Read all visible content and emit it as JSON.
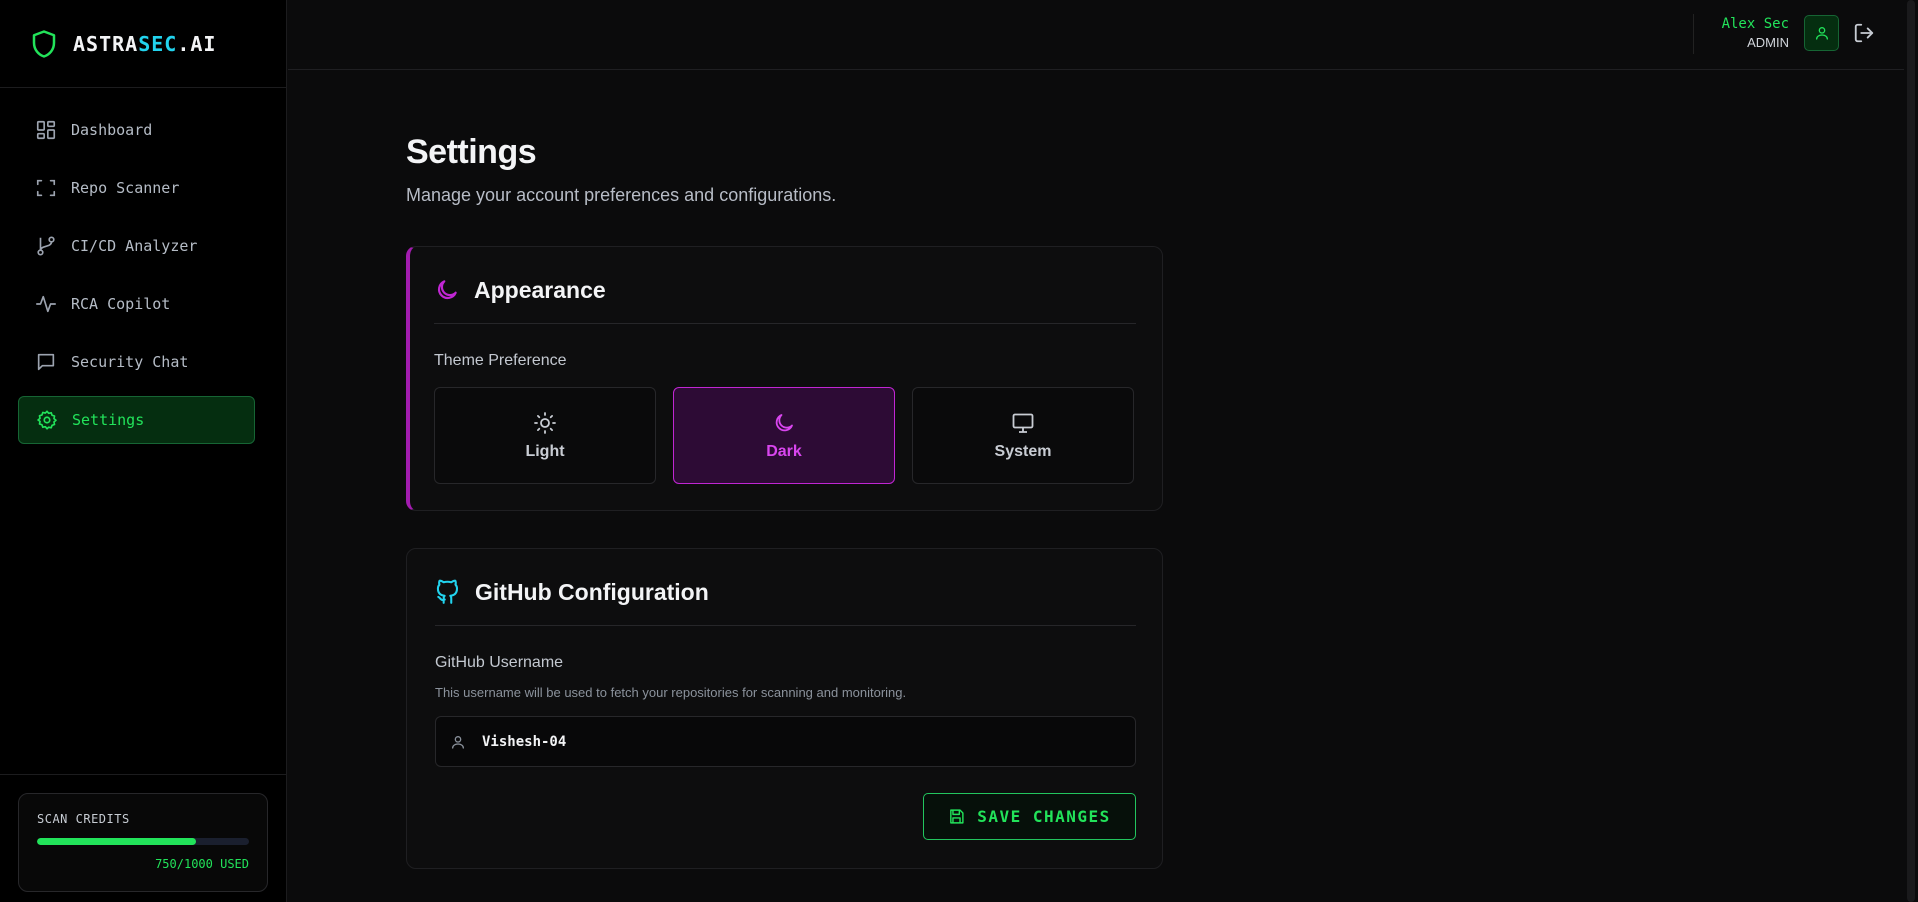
{
  "brand": {
    "prefix": "ASTRA",
    "accent": "SEC",
    "suffix": ".AI",
    "accent_color": "#22d3ee"
  },
  "sidebar": {
    "items": [
      {
        "label": "Dashboard",
        "icon": "grid-icon"
      },
      {
        "label": "Repo Scanner",
        "icon": "scan-icon"
      },
      {
        "label": "CI/CD Analyzer",
        "icon": "git-branch-icon"
      },
      {
        "label": "RCA Copilot",
        "icon": "activity-icon"
      },
      {
        "label": "Security Chat",
        "icon": "chat-icon"
      },
      {
        "label": "Settings",
        "icon": "gear-icon",
        "active": true
      }
    ],
    "credits": {
      "title": "SCAN CREDITS",
      "used": 750,
      "total": 1000,
      "used_label": "750/1000 USED",
      "fraction": 0.75
    }
  },
  "header": {
    "user_name": "Alex Sec",
    "user_role": "ADMIN"
  },
  "page": {
    "title": "Settings",
    "subtitle": "Manage your account preferences and configurations."
  },
  "appearance": {
    "title": "Appearance",
    "theme_label": "Theme Preference",
    "options": [
      {
        "label": "Light",
        "icon": "sun-icon"
      },
      {
        "label": "Dark",
        "icon": "moon-icon",
        "selected": true
      },
      {
        "label": "System",
        "icon": "monitor-icon"
      }
    ]
  },
  "github": {
    "title": "GitHub Configuration",
    "username_label": "GitHub Username",
    "hint": "This username will be used to fetch your repositories for scanning and monitoring.",
    "username_value": "Vishesh-04",
    "save_label": "SAVE CHANGES"
  },
  "colors": {
    "primary_green": "#22e35a",
    "accent_purple": "#c026d3",
    "accent_cyan": "#22d3ee",
    "background": "#0b0b0c"
  }
}
